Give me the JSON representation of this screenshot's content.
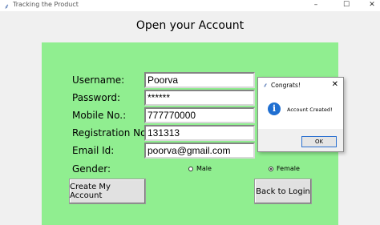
{
  "window": {
    "title": "Tracking the Product",
    "controls": [
      "–",
      "☐",
      "✕"
    ]
  },
  "form": {
    "heading": "Open your  Account",
    "panel_color": "#90ee90",
    "fields": [
      {
        "label": "Username:",
        "value": "Poorva"
      },
      {
        "label": "Password:",
        "value": "******"
      },
      {
        "label": "Mobile No.:",
        "value": "777770000"
      },
      {
        "label": "Registration No.:",
        "value": "131313"
      },
      {
        "label": "Email Id:",
        "value": "poorva@gmail.com"
      }
    ],
    "gender": {
      "label": "Gender:",
      "options": [
        {
          "label": "Male",
          "selected": false
        },
        {
          "label": "Female",
          "selected": true
        }
      ]
    },
    "buttons": {
      "create": "Create My Account",
      "back": "Back to Login"
    }
  },
  "dialog": {
    "title": "Congrats!",
    "close": "✕",
    "icon": "info-icon",
    "message": "Account Created!",
    "ok": "OK"
  }
}
